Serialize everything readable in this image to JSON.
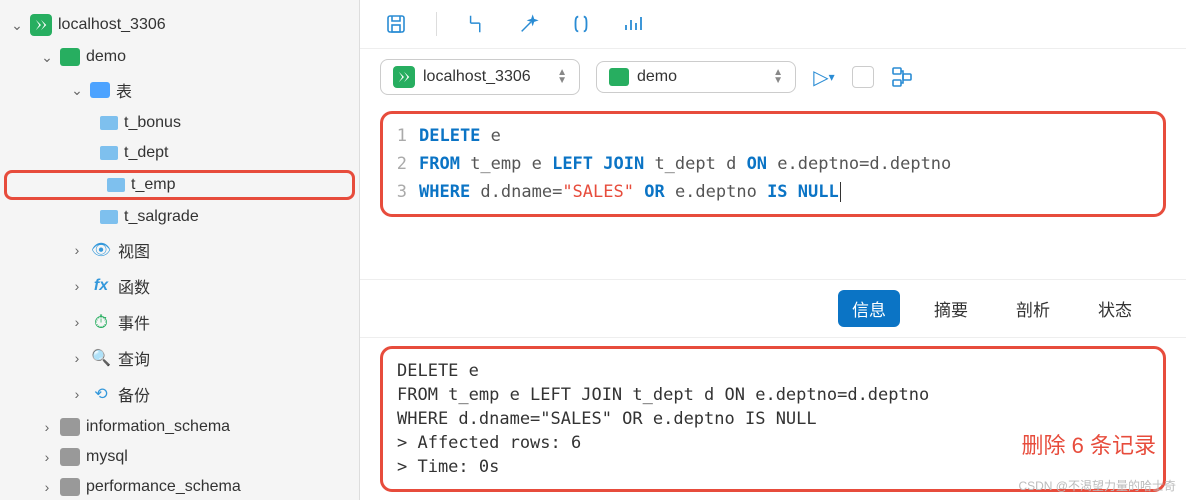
{
  "sidebar": {
    "connection": "localhost_3306",
    "dbs": {
      "demo": "demo",
      "tables_label": "表",
      "tables": [
        "t_bonus",
        "t_dept",
        "t_emp",
        "t_salgrade"
      ],
      "views": "视图",
      "functions": "函数",
      "events": "事件",
      "queries": "查询",
      "backups": "备份",
      "info_schema": "information_schema",
      "mysql": "mysql",
      "perf_schema": "performance_schema"
    }
  },
  "selectors": {
    "connection": "localhost_3306",
    "database": "demo"
  },
  "code": {
    "lines": [
      "1",
      "2",
      "3"
    ],
    "l1": {
      "kw1": "DELETE",
      "t1": " e"
    },
    "l2": {
      "kw1": "FROM",
      "t1": " t_emp e ",
      "kw2": "LEFT JOIN",
      "t2": " t_dept d ",
      "kw3": "ON",
      "t3": " e.deptno=d.deptno"
    },
    "l3": {
      "kw1": "WHERE",
      "t1": " d.dname=",
      "str": "\"SALES\"",
      "t2": " ",
      "kw2": "OR",
      "t3": " e.deptno ",
      "kw3": "IS NULL"
    }
  },
  "tabs": {
    "info": "信息",
    "summary": "摘要",
    "profile": "剖析",
    "status": "状态"
  },
  "output": "DELETE e\nFROM t_emp e LEFT JOIN t_dept d ON e.deptno=d.deptno\nWHERE d.dname=\"SALES\" OR e.deptno IS NULL\n> Affected rows: 6\n> Time: 0s",
  "annotation": "删除 6 条记录",
  "watermark": "CSDN @不渴望力量的哈士奇"
}
